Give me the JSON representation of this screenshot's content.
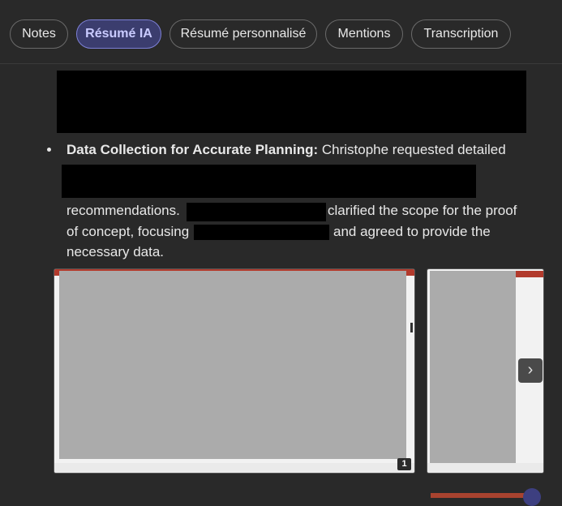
{
  "tabs": [
    {
      "label": "Notes"
    },
    {
      "label": "Résumé IA",
      "active": true
    },
    {
      "label": "Résumé personnalisé"
    },
    {
      "label": "Mentions"
    },
    {
      "label": "Transcription"
    }
  ],
  "summary": {
    "bullet_title": "Data Collection for Accurate Planning:",
    "line1_rest": " Christophe requested detailed",
    "line3_a": "recommendations.",
    "line3_b": "clarified the scope for the proof",
    "line4_a": "of concept, focusing",
    "line4_b": "and agreed to provide the",
    "line5": "necessary data."
  },
  "gallery": {
    "first_badge": "1",
    "next_icon": "chevron-right-icon",
    "next_glyph": "›"
  },
  "colors": {
    "background": "#292929",
    "active_tab_bg": "#3b3d6e",
    "active_tab_text": "#c9cbff",
    "redaction": "#000000"
  }
}
